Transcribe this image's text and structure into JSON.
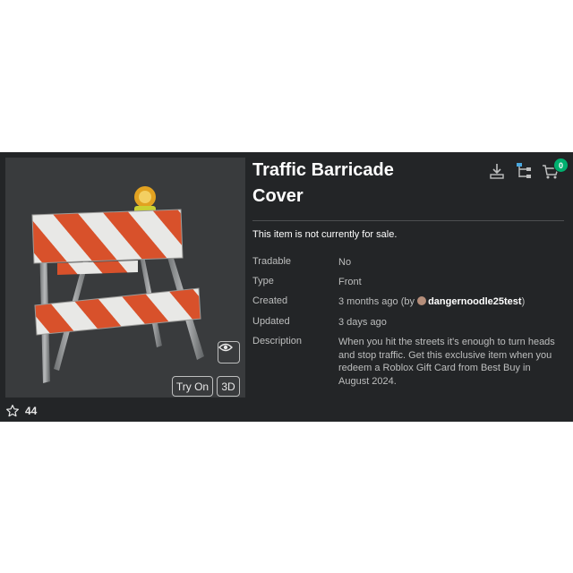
{
  "item": {
    "title_line1": "Traffic Barricade",
    "title_line2": "Cover",
    "sale_status": "This item is not currently for sale.",
    "favorites": "44"
  },
  "details": {
    "tradable_label": "Tradable",
    "tradable_value": "No",
    "type_label": "Type",
    "type_value": "Front",
    "created_label": "Created",
    "created_value": "3 months ago (by",
    "creator_name": "dangernoodle25test",
    "created_close": ")",
    "updated_label": "Updated",
    "updated_value": "3 days ago",
    "description_label": "Description",
    "description_value": "When you hit the streets it's enough to turn heads and stop traffic. Get this exclusive item when you redeem a Roblox Gift Card from Best Buy in August 2024."
  },
  "actions": {
    "try_on_label": "Try On",
    "three_d_label": "3D"
  },
  "header": {
    "cart_count": "0",
    "icons": [
      "download-icon",
      "hierarchy-icon",
      "cart-icon"
    ]
  },
  "colors": {
    "panel_bg": "#232527",
    "thumb_bg": "#393b3d",
    "stripe_orange": "#d8512b",
    "stripe_white": "#e8e8e6",
    "badge_green": "#00b06f"
  }
}
